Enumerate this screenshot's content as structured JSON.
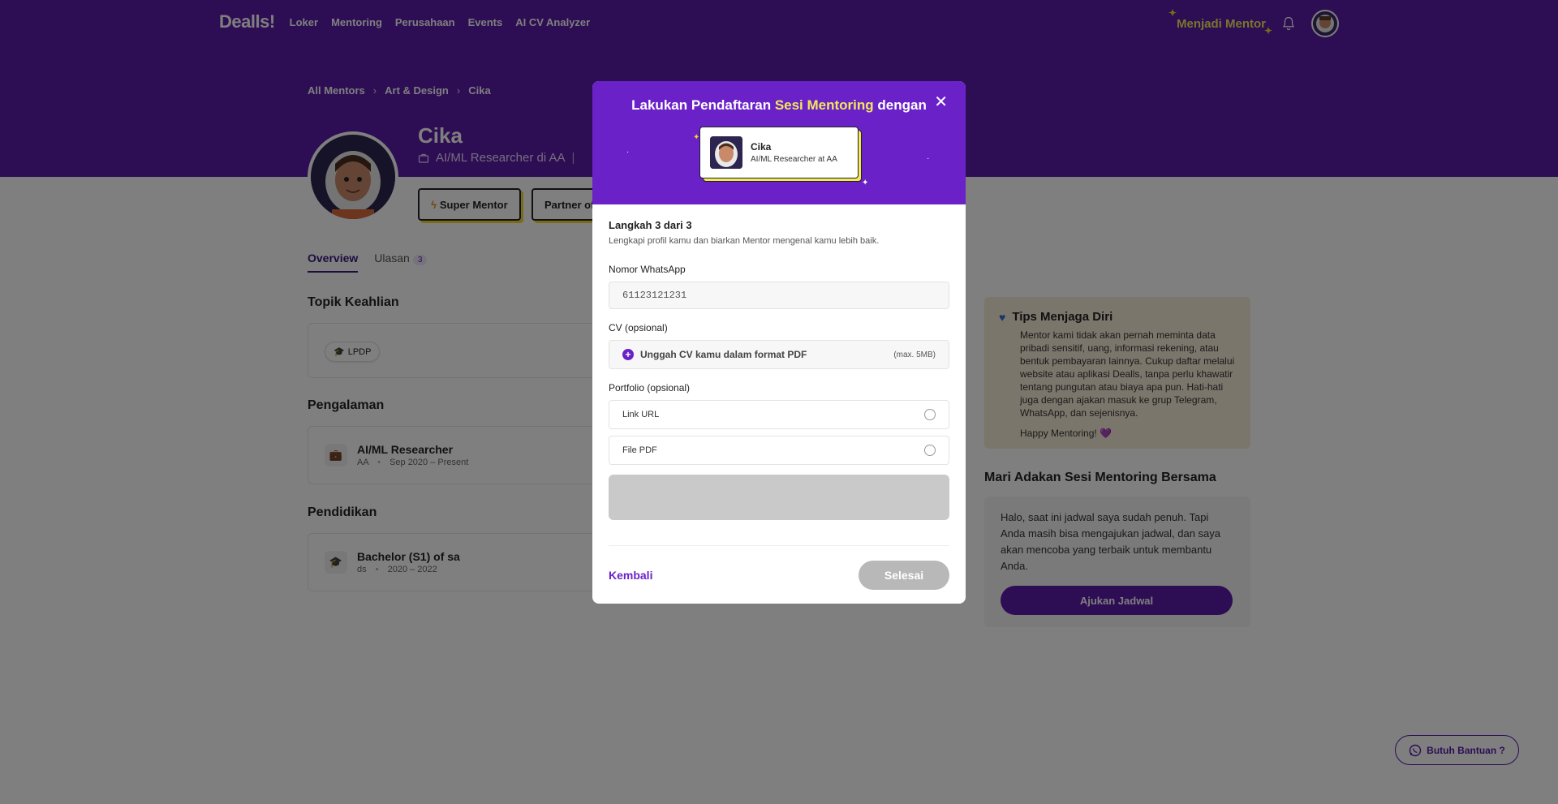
{
  "nav": {
    "logo": "Dealls!",
    "links": [
      "Loker",
      "Mentoring",
      "Perusahaan",
      "Events",
      "AI CV Analyzer"
    ],
    "mentor_link": "Menjadi Mentor"
  },
  "breadcrumb": [
    "All Mentors",
    "Art & Design",
    "Cika"
  ],
  "profile": {
    "name": "Cika",
    "role": "AI/ML Researcher di AA",
    "badges": [
      "Super Mentor",
      "Partner of"
    ]
  },
  "tabs": [
    {
      "label": "Overview"
    },
    {
      "label": "Ulasan",
      "count": "3"
    }
  ],
  "topik": {
    "title": "Topik Keahlian",
    "chips": [
      "LPDP"
    ]
  },
  "pengalaman": {
    "title": "Pengalaman",
    "items": [
      {
        "title": "AI/ML Researcher",
        "company": "AA",
        "period": "Sep 2020 – Present"
      }
    ]
  },
  "pendidikan": {
    "title": "Pendidikan",
    "items": [
      {
        "title": "Bachelor (S1) of sa",
        "school": "ds",
        "period": "2020 – 2022"
      }
    ]
  },
  "tips": {
    "title": "Tips Menjaga Diri",
    "body": "Mentor kami tidak akan pernah meminta data pribadi sensitif, uang, informasi rekening, atau bentuk pembayaran lainnya. Cukup daftar melalui website atau aplikasi Dealls, tanpa perlu khawatir tentang pungutan atau biaya apa pun. Hati-hati juga dengan ajakan masuk ke grup Telegram, WhatsApp, dan sejenisnya.",
    "footer": "Happy Mentoring! 💜"
  },
  "sesi": {
    "title": "Mari Adakan Sesi Mentoring Bersama",
    "text": "Halo, saat ini jadwal saya sudah penuh. Tapi Anda masih bisa mengajukan jadwal, dan saya akan mencoba yang terbaik untuk membantu Anda.",
    "button": "Ajukan Jadwal"
  },
  "help_button": "Butuh Bantuan ?",
  "modal": {
    "title_pre": "Lakukan Pendaftaran ",
    "title_hl": "Sesi Mentoring",
    "title_post": " dengan",
    "mentor_name": "Cika",
    "mentor_role": "AI/ML Researcher at AA",
    "step": "Langkah 3 dari 3",
    "step_sub": "Lengkapi profil kamu dan biarkan Mentor mengenal kamu lebih baik.",
    "whatsapp_label": "Nomor WhatsApp",
    "whatsapp_value": "61123121231",
    "cv_label": "CV (opsional)",
    "cv_upload": "Unggah CV kamu dalam format PDF",
    "cv_max": "(max. 5MB)",
    "portfolio_label": "Portfolio (opsional)",
    "portfolio_options": [
      "Link URL",
      "File PDF"
    ],
    "back": "Kembali",
    "done": "Selesai"
  },
  "colors": {
    "brand": "#5a1aa8",
    "modal_header": "#6a22c8",
    "highlight": "#f2e85a"
  }
}
